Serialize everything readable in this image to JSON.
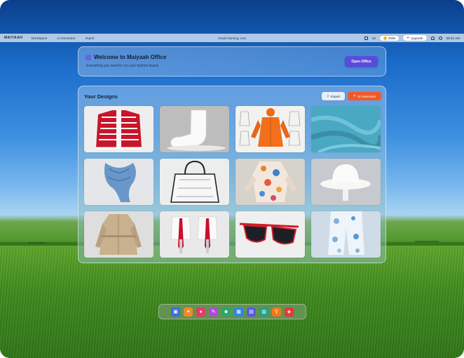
{
  "topbar": {
    "brand": "MAIYAAH",
    "nav": [
      "Workspace",
      "AI Generator",
      "Import"
    ],
    "greeting": "Good morning, Leo",
    "credits": "2589",
    "upgrade_label": "Upgrade",
    "time": "08:42 AM",
    "tray_label": "43"
  },
  "welcome": {
    "title": "Welcome to Maiyaah Office",
    "subtitle": "Everything you need to run your fashion brand.",
    "open_label": "Open Office"
  },
  "designs": {
    "title": "Your Designs",
    "import_label": "Import",
    "generator_label": "AI Generator",
    "items": [
      {
        "name": "red-knit-cardigan"
      },
      {
        "name": "white-ankle-sock"
      },
      {
        "name": "orange-raincoat-sketches"
      },
      {
        "name": "blue-knit-fabric"
      },
      {
        "name": "blue-silk-scarf"
      },
      {
        "name": "clear-tote-bag"
      },
      {
        "name": "floral-robe"
      },
      {
        "name": "white-bucket-hat"
      },
      {
        "name": "beige-trench-coat"
      },
      {
        "name": "red-ties-on-mannequins"
      },
      {
        "name": "red-sunglasses"
      },
      {
        "name": "blue-floral-shorts"
      }
    ]
  },
  "dock": {
    "apps": [
      {
        "name": "gallery",
        "color": "#3a6fe0",
        "glyph": "▣"
      },
      {
        "name": "mix",
        "color": "#f0892a",
        "glyph": "✦"
      },
      {
        "name": "shirt",
        "color": "#e53a6a",
        "glyph": "♦"
      },
      {
        "name": "brush",
        "color": "#b14ad8",
        "glyph": "✎"
      },
      {
        "name": "people",
        "color": "#2aa86a",
        "glyph": "☻"
      },
      {
        "name": "calendar",
        "color": "#2f86e0",
        "glyph": "▦"
      },
      {
        "name": "store",
        "color": "#5a5ae0",
        "glyph": "▤"
      },
      {
        "name": "print",
        "color": "#22a08a",
        "glyph": "▥"
      },
      {
        "name": "search",
        "color": "#f07a1a",
        "glyph": "⚲"
      },
      {
        "name": "box",
        "color": "#e03a3a",
        "glyph": "◈"
      }
    ]
  }
}
